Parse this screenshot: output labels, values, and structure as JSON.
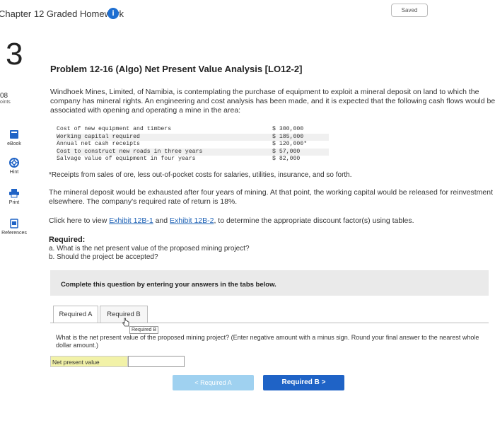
{
  "header": {
    "chapter_title": "Chapter 12 Graded Homework",
    "info_glyph": "i",
    "saved_label": "Saved"
  },
  "question": {
    "number": "3",
    "points_value": "08",
    "points_label": "oints"
  },
  "sidebar": {
    "tools": [
      {
        "label": "eBook",
        "icon": "book-icon"
      },
      {
        "label": "Hint",
        "icon": "lifebuoy-icon"
      },
      {
        "label": "Print",
        "icon": "printer-icon"
      },
      {
        "label": "References",
        "icon": "document-icon"
      }
    ]
  },
  "problem": {
    "title": "Problem 12-16 (Algo) Net Present Value Analysis [LO12-2]",
    "intro": "Windhoek Mines, Limited, of Namibia, is contemplating the purchase of equipment to exploit a mineral deposit on land to which the company has mineral rights. An engineering and cost analysis has been made, and it is expected that the following cash flows would be associated with opening and operating a mine in the area:",
    "cash_flows": [
      {
        "label": "Cost of new equipment and timbers",
        "amount": "$ 300,000"
      },
      {
        "label": "Working capital required",
        "amount": "$ 185,000"
      },
      {
        "label": "Annual net cash receipts",
        "amount": "$ 120,000*"
      },
      {
        "label": "Cost to construct new roads in three years",
        "amount": "$ 57,000"
      },
      {
        "label": "Salvage value of equipment in four years",
        "amount": "$ 82,000"
      }
    ],
    "footnote": "*Receipts from sales of ore, less out-of-pocket costs for salaries, utilities, insurance, and so forth.",
    "exhaust_text": "The mineral deposit would be exhausted after four years of mining. At that point, the working capital would be released for reinvestment elsewhere. The company's required rate of return is 18%.",
    "click_prefix": "Click here to view ",
    "exhibit1_link": "Exhibit 12B-1",
    "and_text": " and ",
    "exhibit2_link": "Exhibit 12B-2",
    "click_suffix": ", to determine the appropriate discount factor(s) using tables.",
    "required_heading": "Required:",
    "required_a": "a. What is the net present value of the proposed mining project?",
    "required_b": "b. Should the project be accepted?"
  },
  "answer_area": {
    "instruction": "Complete this question by entering your answers in the tabs below.",
    "tabs": [
      {
        "label": "Required A"
      },
      {
        "label": "Required B"
      }
    ],
    "tooltip": "Required B",
    "tab_question": "What is the net present value of the proposed mining project? (Enter negative amount with a minus sign. Round your final answer to the nearest whole dollar amount.)",
    "npv_label": "Net present value",
    "npv_value": "",
    "prev_label": "< Required A",
    "next_label": "Required B  >"
  },
  "colors": {
    "accent": "#1f63c6",
    "info": "#1f6fd1",
    "label_highlight": "#f2f2a8"
  }
}
